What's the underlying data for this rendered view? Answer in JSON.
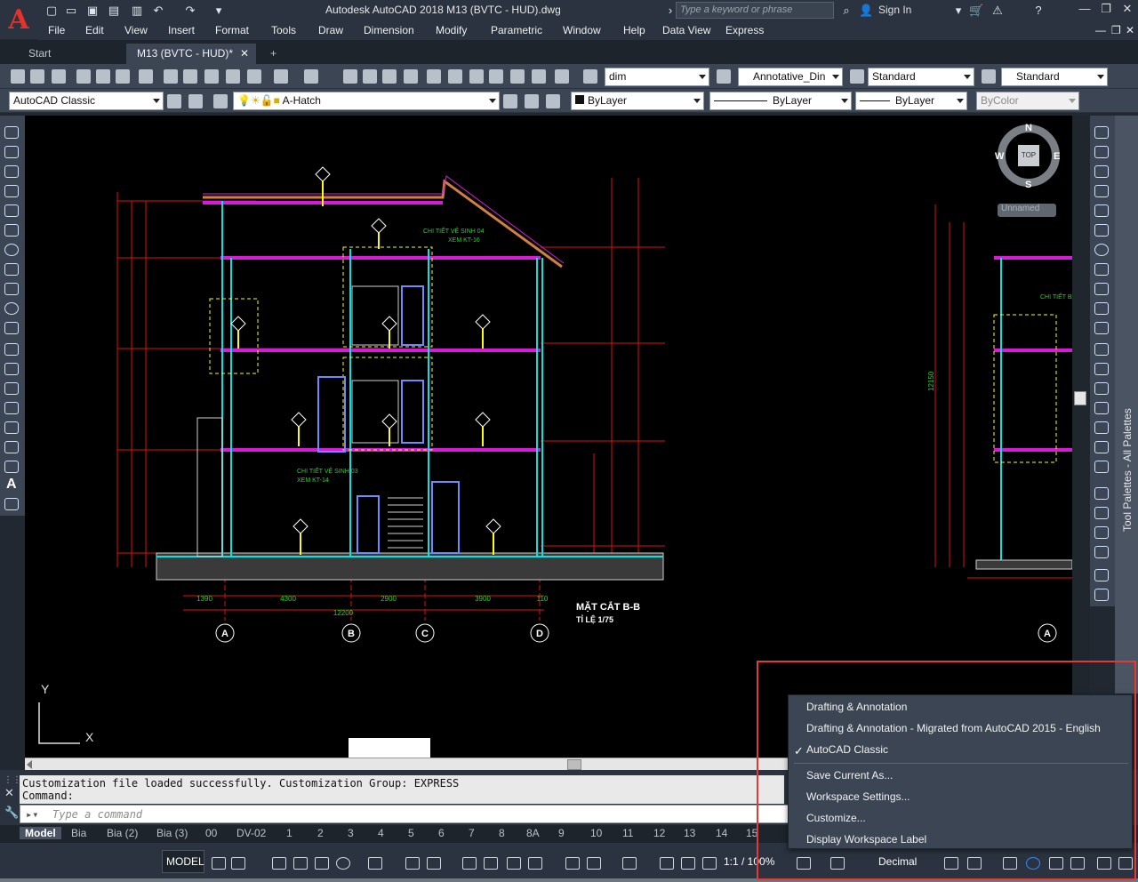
{
  "app": {
    "logo_letter": "A",
    "title": "Autodesk AutoCAD 2018    M13 (BVTC - HUD).dwg",
    "search_placeholder": "Type a keyword or phrase",
    "sign_in": "Sign In"
  },
  "menu": [
    "File",
    "Edit",
    "View",
    "Insert",
    "Format",
    "Tools",
    "Draw",
    "Dimension",
    "Modify",
    "Parametric",
    "Window",
    "Help",
    "Data View",
    "Express"
  ],
  "doc_tabs": {
    "start": "Start",
    "active": "M13 (BVTC - HUD)*",
    "new": "+"
  },
  "toolbar": {
    "dim_style": "dim",
    "annotative": "Annotative_Din",
    "text_style": "Standard",
    "table_style": "Standard",
    "workspace": "AutoCAD Classic",
    "layer": "A-Hatch",
    "color": "ByLayer",
    "linetype": "ByLayer",
    "lineweight": "ByLayer",
    "plotstyle": "ByColor"
  },
  "viewcube": {
    "north": "N",
    "south": "S",
    "east": "E",
    "west": "W",
    "face": "TOP",
    "ucs": "Unnamed"
  },
  "ucs_icon": {
    "y": "Y",
    "x": "X"
  },
  "drawing_texts": {
    "section_title": "MẶT CẮT B-B",
    "scale": "TỈ LỆ 1/75",
    "grid_a": "A",
    "grid_b": "B",
    "grid_c": "C",
    "grid_d": "D",
    "grid_a2": "A",
    "total_dim": "12200",
    "dim_1390": "1390",
    "dim_4300": "4300",
    "dim_2900": "2900",
    "dim_3900": "3900",
    "dim_110": "110",
    "note_1": "CHI TIẾT VỆ SINH 04",
    "note_1b": "XEM KT-16",
    "note_2": "CHI TIẾT VỆ SINH 03",
    "note_2b": "XEM KT-14",
    "right_dim": "12150",
    "right_note": "CHI TIẾT BAN"
  },
  "tool_palettes_label": "Tool Palettes - All Palettes",
  "command": {
    "history_1": "Customization file loaded successfully. Customization Group: EXPRESS",
    "history_2": "Command:",
    "placeholder": "Type a command"
  },
  "layout_tabs": [
    "Model",
    "Bia",
    "Bia (2)",
    "Bia (3)",
    "00",
    "DV-02",
    "1",
    "2",
    "3",
    "4",
    "5",
    "6",
    "7",
    "8",
    "8A",
    "9",
    "10",
    "11",
    "12",
    "13",
    "14",
    "15"
  ],
  "status": {
    "model": "MODEL",
    "scale": "1:1 / 100%",
    "units": "Decimal"
  },
  "workspace_menu": {
    "items": [
      "Drafting & Annotation",
      "Drafting & Annotation - Migrated from AutoCAD 2015 - English",
      "AutoCAD Classic"
    ],
    "checked": "✓",
    "actions": [
      "Save Current As...",
      "Workspace Settings...",
      "Customize...",
      "Display Workspace Label"
    ]
  },
  "colors": {
    "accent_red": "#e53935",
    "cad_magenta": "#d81bd8",
    "cad_cyan": "#00e5e5",
    "cad_red": "#e01010",
    "cad_green": "#18e018",
    "cad_yellow": "#ffff00"
  }
}
